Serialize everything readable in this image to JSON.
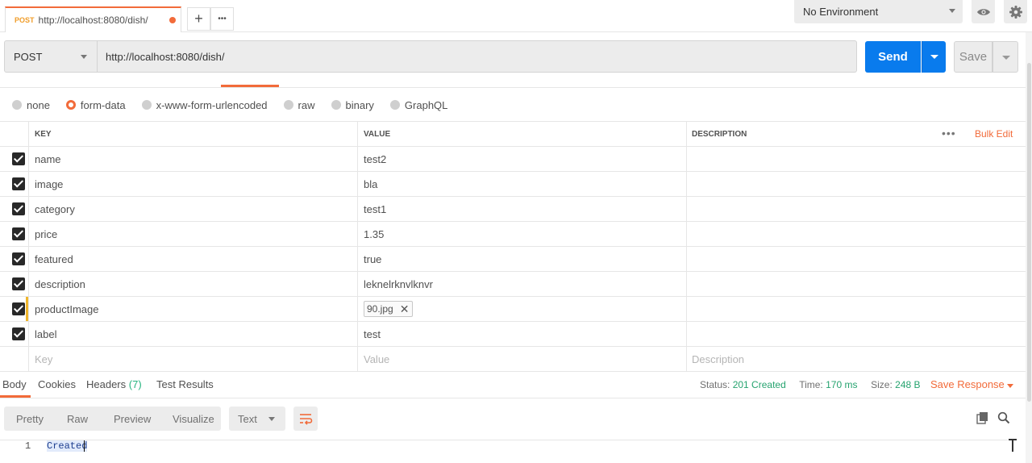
{
  "tab": {
    "method": "POST",
    "url": "http://localhost:8080/dish/",
    "new_tab_symbol": "+",
    "more_symbol": "•••"
  },
  "environment": {
    "selected": "No Environment"
  },
  "request": {
    "method": "POST",
    "url": "http://localhost:8080/dish/",
    "send_label": "Send",
    "save_label": "Save"
  },
  "body_types": [
    {
      "label": "none",
      "selected": false
    },
    {
      "label": "form-data",
      "selected": true
    },
    {
      "label": "x-www-form-urlencoded",
      "selected": false
    },
    {
      "label": "raw",
      "selected": false
    },
    {
      "label": "binary",
      "selected": false
    },
    {
      "label": "GraphQL",
      "selected": false
    }
  ],
  "params_table": {
    "headers": {
      "key": "KEY",
      "value": "VALUE",
      "description": "DESCRIPTION"
    },
    "bulk_edit": "Bulk Edit",
    "rows": [
      {
        "key": "name",
        "value": "test2",
        "checked": true
      },
      {
        "key": "image",
        "value": "bla",
        "checked": true
      },
      {
        "key": "category",
        "value": "test1",
        "checked": true
      },
      {
        "key": "price",
        "value": "1.35",
        "checked": true
      },
      {
        "key": "featured",
        "value": "true",
        "checked": true
      },
      {
        "key": "description",
        "value": "leknelrknvlknvr",
        "checked": true
      },
      {
        "key": "productImage",
        "value": "90.jpg",
        "checked": true,
        "type": "file"
      },
      {
        "key": "label",
        "value": "test",
        "checked": true
      }
    ],
    "placeholders": {
      "key": "Key",
      "value": "Value",
      "description": "Description"
    }
  },
  "response": {
    "tabs": {
      "body": "Body",
      "cookies": "Cookies",
      "headers": "Headers",
      "headers_count": "(7)",
      "test_results": "Test Results"
    },
    "status_label": "Status:",
    "status_value": "201 Created",
    "time_label": "Time:",
    "time_value": "170 ms",
    "size_label": "Size:",
    "size_value": "248 B",
    "save_response": "Save Response",
    "view_modes": [
      "Pretty",
      "Raw",
      "Preview",
      "Visualize"
    ],
    "format": "Text",
    "body_lines": [
      {
        "line": "1",
        "text": "Created"
      }
    ]
  },
  "colors": {
    "accent": "#f26b3a",
    "send_button": "#097bed",
    "status_ok": "#26a36f"
  }
}
